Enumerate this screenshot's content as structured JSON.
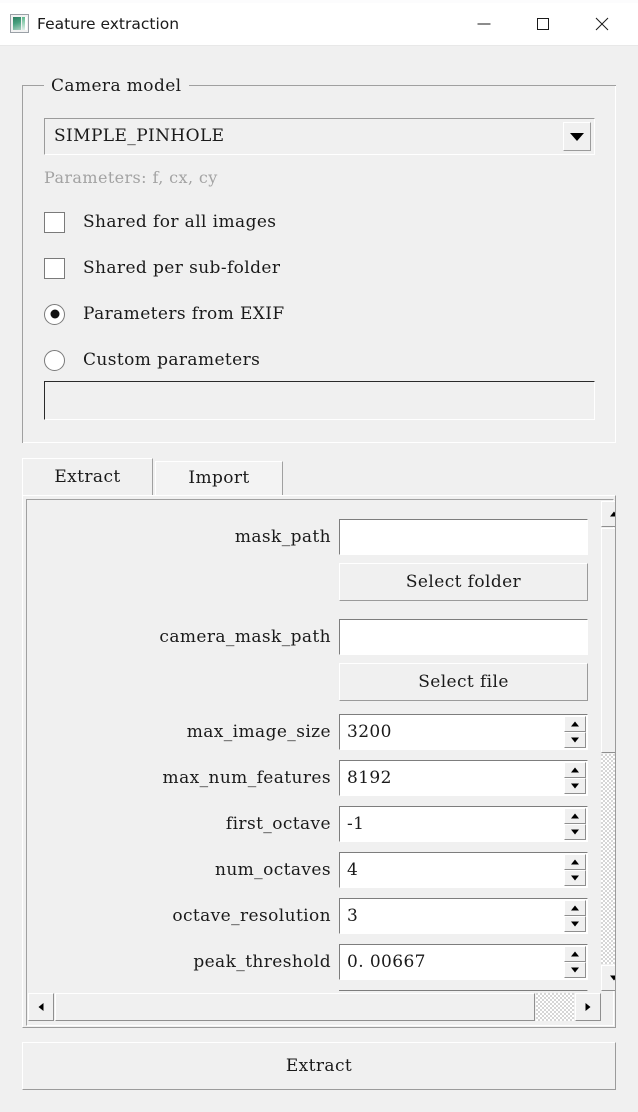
{
  "window": {
    "title": "Feature extraction",
    "icon": "image-thumbnail-icon",
    "controls": {
      "minimize": "—",
      "maximize": "□",
      "close": "✕"
    }
  },
  "camera_model_group": {
    "title": "Camera model",
    "combo": {
      "selected": "SIMPLE_PINHOLE",
      "arrow": "chevron-down-icon"
    },
    "parameters_hint": "Parameters: f, cx, cy",
    "options": [
      {
        "type": "checkbox",
        "label": "Shared for all images",
        "checked": false
      },
      {
        "type": "checkbox",
        "label": "Shared per sub-folder",
        "checked": false
      },
      {
        "type": "radio",
        "label": "Parameters from EXIF",
        "checked": true
      },
      {
        "type": "radio",
        "label": "Custom parameters",
        "checked": false
      }
    ],
    "custom_params_input": {
      "value": "",
      "enabled": false
    }
  },
  "tabs": [
    {
      "label": "Extract",
      "active": true
    },
    {
      "label": "Import",
      "active": false
    }
  ],
  "extract_tab": {
    "rows": [
      {
        "kind": "text",
        "label": "mask_path",
        "value": ""
      },
      {
        "kind": "button",
        "label": "Select folder"
      },
      {
        "kind": "text",
        "label": "camera_mask_path",
        "value": ""
      },
      {
        "kind": "button",
        "label": "Select file"
      },
      {
        "kind": "spin",
        "label": "max_image_size",
        "value": "3200"
      },
      {
        "kind": "spin",
        "label": "max_num_features",
        "value": "8192"
      },
      {
        "kind": "spin",
        "label": "first_octave",
        "value": "-1"
      },
      {
        "kind": "spin",
        "label": "num_octaves",
        "value": "4"
      },
      {
        "kind": "spin",
        "label": "octave_resolution",
        "value": "3"
      },
      {
        "kind": "spin",
        "label": "peak_threshold",
        "value": "0. 00667"
      }
    ],
    "vertical_scrollbar": {
      "up_arrow": "triangle-up-icon",
      "down_arrow": "triangle-down-icon",
      "thumb_position_percent": 0
    },
    "horizontal_scrollbar": {
      "left_arrow": "triangle-left-icon",
      "right_arrow": "triangle-right-icon",
      "thumb_position_percent": 0
    }
  },
  "footer": {
    "extract_button": "Extract"
  },
  "colors": {
    "window_background": "#f0f0f0",
    "titlebar_background": "#ffffff",
    "field_background": "#ffffff",
    "text": "#1a1a1a",
    "hint_text": "#a3a3a3",
    "border_dark": "#9b9b9b",
    "icon_accent": "#46a07d"
  }
}
